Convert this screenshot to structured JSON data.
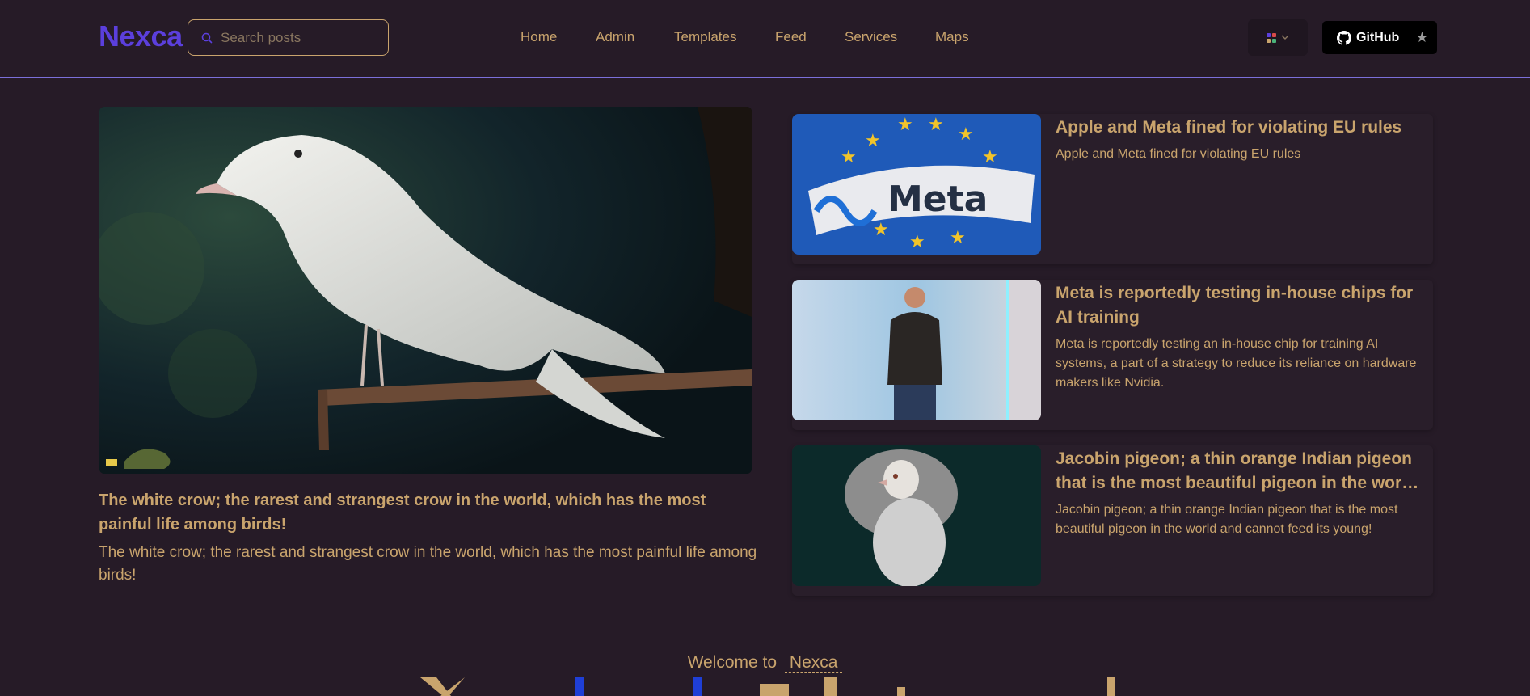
{
  "header": {
    "logo": "Nexca",
    "search": {
      "placeholder": "Search posts",
      "value": ""
    },
    "nav": [
      "Home",
      "Admin",
      "Templates",
      "Feed",
      "Services",
      "Maps"
    ],
    "github_label": "GitHub",
    "colors": {
      "accent": "#5b3fdc",
      "text": "#c9a46d",
      "background": "#261b27",
      "divider": "#7b6fd9"
    }
  },
  "featured": {
    "title": "The white crow; the rarest and strangest crow in the world, which has the most painful life among birds!",
    "description": "The white crow; the rarest and strangest crow in the world, which has the most painful life among birds!"
  },
  "posts": [
    {
      "title": "Apple and Meta fined for violating EU rules",
      "description": "Apple and Meta fined for violating EU rules",
      "image_text": "Meta"
    },
    {
      "title": "Meta is reportedly testing in-house chips for AI training",
      "description": "Meta is reportedly testing an in-house chip for training AI systems, a part of a strategy to reduce its reliance on hardware makers like Nvidia."
    },
    {
      "title": "Jacobin pigeon; a thin orange Indian pigeon that is the most beautiful pigeon in the world and cannot feed its young!",
      "description": "Jacobin pigeon; a thin orange Indian pigeon that is the most beautiful pigeon in the world and cannot feed its young!"
    }
  ],
  "welcome": {
    "prefix": "Welcome to",
    "brand": "Nexca"
  },
  "icons": [
    "search-icon",
    "palette-icon",
    "chevron-down-icon",
    "github-icon",
    "star-icon"
  ]
}
